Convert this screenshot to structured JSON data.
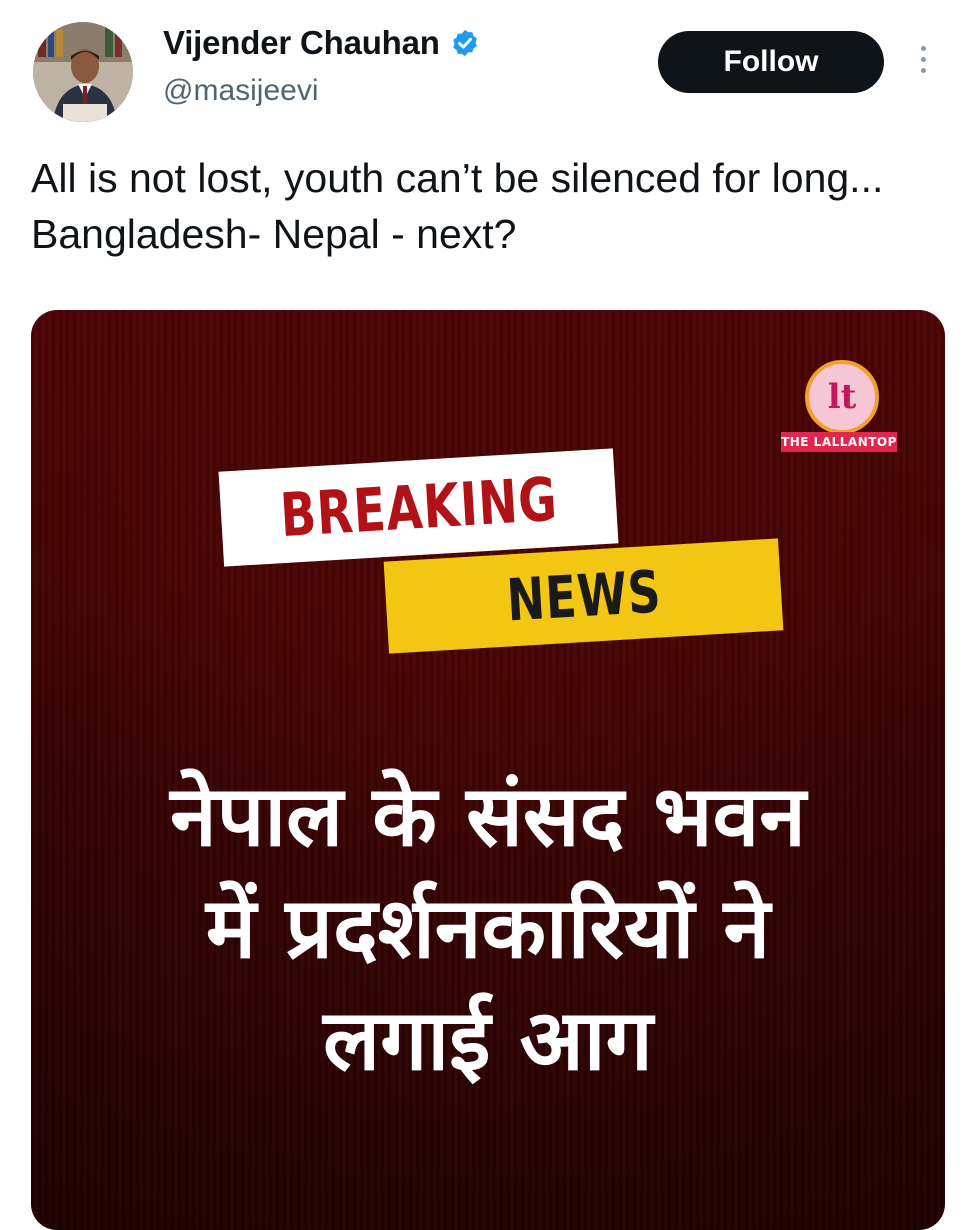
{
  "author": {
    "name": "Vijender Chauhan",
    "handle": "@masijeevi",
    "verified": true,
    "verified_color": "#1d9bf0"
  },
  "actions": {
    "follow_label": "Follow",
    "more_icon": "more-vertical-icon"
  },
  "tweet": {
    "text": "All is not lost, youth can’t be silenced for long... Bangladesh- Nepal - next?"
  },
  "media": {
    "logo_text": "THE LALLANTOP",
    "breaking_label": "BREAKING",
    "news_label": "NEWS",
    "headline_lines": [
      "नेपाल के संसद भवन",
      "में प्रदर्शनकारियों ने",
      "लगाई आग"
    ],
    "colors": {
      "background": "#5a0505",
      "breaking_text": "#b11217",
      "news_banner": "#f3c614"
    }
  }
}
